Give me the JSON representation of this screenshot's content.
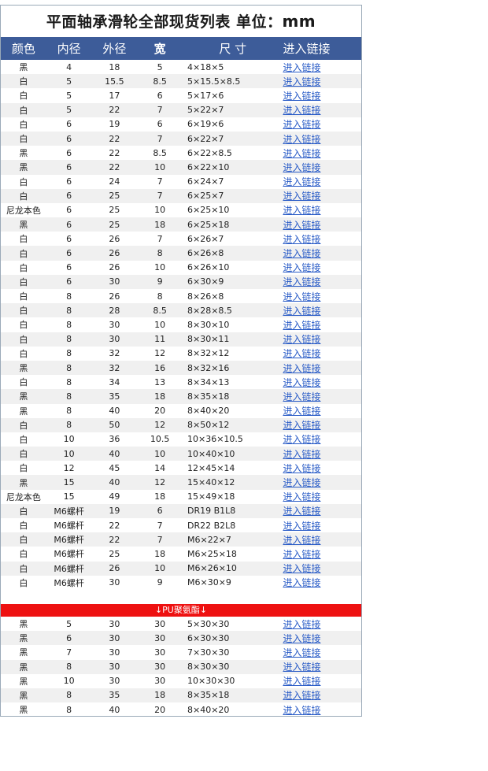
{
  "title": "平面轴承滑轮全部现货列表 单位：",
  "unit": "mm",
  "headers": [
    "颜色",
    "内径",
    "外径",
    "宽",
    "尺 寸",
    "进入链接"
  ],
  "rows": [
    [
      "黑",
      "4",
      "18",
      "5",
      "4×18×5",
      "进入链接"
    ],
    [
      "白",
      "5",
      "15.5",
      "8.5",
      "5×15.5×8.5",
      "进入链接"
    ],
    [
      "白",
      "5",
      "17",
      "6",
      "5×17×6",
      "进入链接"
    ],
    [
      "白",
      "5",
      "22",
      "7",
      "5×22×7",
      "进入链接"
    ],
    [
      "白",
      "6",
      "19",
      "6",
      "6×19×6",
      "进入链接"
    ],
    [
      "白",
      "6",
      "22",
      "7",
      "6×22×7",
      "进入链接"
    ],
    [
      "黑",
      "6",
      "22",
      "8.5",
      "6×22×8.5",
      "进入链接"
    ],
    [
      "黑",
      "6",
      "22",
      "10",
      "6×22×10",
      "进入链接"
    ],
    [
      "白",
      "6",
      "24",
      "7",
      "6×24×7",
      "进入链接"
    ],
    [
      "白",
      "6",
      "25",
      "7",
      "6×25×7",
      "进入链接"
    ],
    [
      "尼龙本色",
      "6",
      "25",
      "10",
      "6×25×10",
      "进入链接"
    ],
    [
      "黑",
      "6",
      "25",
      "18",
      "6×25×18",
      "进入链接"
    ],
    [
      "白",
      "6",
      "26",
      "7",
      "6×26×7",
      "进入链接"
    ],
    [
      "白",
      "6",
      "26",
      "8",
      "6×26×8",
      "进入链接"
    ],
    [
      "白",
      "6",
      "26",
      "10",
      "6×26×10",
      "进入链接"
    ],
    [
      "白",
      "6",
      "30",
      "9",
      "6×30×9",
      "进入链接"
    ],
    [
      "白",
      "8",
      "26",
      "8",
      "8×26×8",
      "进入链接"
    ],
    [
      "白",
      "8",
      "28",
      "8.5",
      "8×28×8.5",
      "进入链接"
    ],
    [
      "白",
      "8",
      "30",
      "10",
      "8×30×10",
      "进入链接"
    ],
    [
      "白",
      "8",
      "30",
      "11",
      "8×30×11",
      "进入链接"
    ],
    [
      "白",
      "8",
      "32",
      "12",
      "8×32×12",
      "进入链接"
    ],
    [
      "黑",
      "8",
      "32",
      "16",
      "8×32×16",
      "进入链接"
    ],
    [
      "白",
      "8",
      "34",
      "13",
      "8×34×13",
      "进入链接"
    ],
    [
      "黑",
      "8",
      "35",
      "18",
      "8×35×18",
      "进入链接"
    ],
    [
      "黑",
      "8",
      "40",
      "20",
      "8×40×20",
      "进入链接"
    ],
    [
      "白",
      "8",
      "50",
      "12",
      "8×50×12",
      "进入链接"
    ],
    [
      "白",
      "10",
      "36",
      "10.5",
      "10×36×10.5",
      "进入链接"
    ],
    [
      "白",
      "10",
      "40",
      "10",
      "10×40×10",
      "进入链接"
    ],
    [
      "白",
      "12",
      "45",
      "14",
      "12×45×14",
      "进入链接"
    ],
    [
      "黑",
      "15",
      "40",
      "12",
      "15×40×12",
      "进入链接"
    ],
    [
      "尼龙本色",
      "15",
      "49",
      "18",
      "15×49×18",
      "进入链接"
    ],
    [
      "白",
      "M6螺杆",
      "19",
      "6",
      "DR19 B1L8",
      "进入链接"
    ],
    [
      "白",
      "M6螺杆",
      "22",
      "7",
      "DR22 B2L8",
      "进入链接"
    ],
    [
      "白",
      "M6螺杆",
      "22",
      "7",
      "M6×22×7",
      "进入链接"
    ],
    [
      "白",
      "M6螺杆",
      "25",
      "18",
      "M6×25×18",
      "进入链接"
    ],
    [
      "白",
      "M6螺杆",
      "26",
      "10",
      "M6×26×10",
      "进入链接"
    ],
    [
      "白",
      "M6螺杆",
      "30",
      "9",
      "M6×30×9",
      "进入链接"
    ]
  ],
  "section_label": "↓PU聚氨酯↓",
  "pu_rows": [
    [
      "黑",
      "5",
      "30",
      "30",
      "5×30×30",
      "进入链接"
    ],
    [
      "黑",
      "6",
      "30",
      "30",
      "6×30×30",
      "进入链接"
    ],
    [
      "黑",
      "7",
      "30",
      "30",
      "7×30×30",
      "进入链接"
    ],
    [
      "黑",
      "8",
      "30",
      "30",
      "8×30×30",
      "进入链接"
    ],
    [
      "黑",
      "10",
      "30",
      "30",
      "10×30×30",
      "进入链接"
    ],
    [
      "黑",
      "8",
      "35",
      "18",
      "8×35×18",
      "进入链接"
    ],
    [
      "黑",
      "8",
      "40",
      "20",
      "8×40×20",
      "进入链接"
    ]
  ],
  "colors": {
    "header_bg": "#3d5c99",
    "section_bar": "#ee1111",
    "link": "#2a5cc7",
    "alt_row": "#f0f0f0"
  }
}
